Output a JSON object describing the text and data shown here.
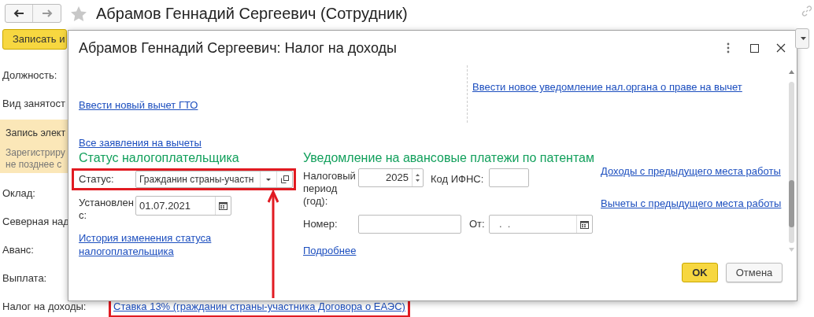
{
  "form": {
    "title": "Абрамов Геннадий Сергеевич (Сотрудник)",
    "primary_button": "Записать и",
    "rows": [
      {
        "kind": "label",
        "label": "Должность:"
      },
      {
        "kind": "label",
        "label": "Вид занятост"
      },
      {
        "kind": "notice",
        "title": "Запись элект",
        "lines": [
          "Зарегистриру",
          "не позднее с"
        ]
      },
      {
        "kind": "label",
        "label": "Оклад:"
      },
      {
        "kind": "label",
        "label": "Северная над"
      },
      {
        "kind": "label",
        "label": "Аванс:"
      },
      {
        "kind": "label",
        "label": "Выплата:"
      },
      {
        "kind": "link",
        "label": "Налог на доходы:",
        "link": "Ставка 13% (гражданин страны-участника Договора о ЕАЭС)"
      }
    ]
  },
  "dialog": {
    "title": "Абрамов Геннадий Сергеевич: Налог на доходы",
    "top_links": [
      "Ввести новый вычет ГТО",
      "Все заявления на вычеты"
    ],
    "notice_link": "Ввести новое уведомление нал.органа о праве на вычет",
    "taxpayer_status": {
      "heading": "Статус налогоплательщика",
      "status_label": "Статус:",
      "status_value": "Гражданин страны-участн",
      "date_label": "Установлен с:",
      "date_value": "01.07.2021",
      "history_link": "История изменения статуса налогоплательщика"
    },
    "patent_notice": {
      "heading": "Уведомление на авансовые платежи по патентам",
      "period_label": "Налоговый период (год):",
      "period_value": "2025",
      "ifns_label": "Код ИФНС:",
      "number_label": "Номер:",
      "from_label": "От:",
      "from_value": ".  .",
      "more_link": "Подробнее"
    },
    "side_links": [
      "Доходы с предыдущего места работы",
      "Вычеты с предыдущего места работы"
    ],
    "buttons": [
      {
        "label": "OK",
        "kind": "primary"
      },
      {
        "label": "Отмена",
        "kind": "default"
      }
    ]
  }
}
